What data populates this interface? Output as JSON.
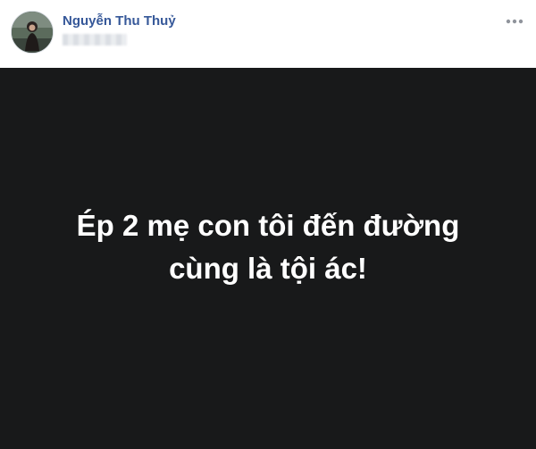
{
  "post": {
    "author_name": "Nguyễn Thu Thuỷ",
    "background_color": "#18191a",
    "text_color": "#ffffff",
    "text_lines": [
      "Ép 2 mẹ con tôi đến đường",
      "cùng là tội ác!"
    ]
  },
  "icons": {
    "avatar": "profile-photo",
    "more": "more-options-icon"
  }
}
